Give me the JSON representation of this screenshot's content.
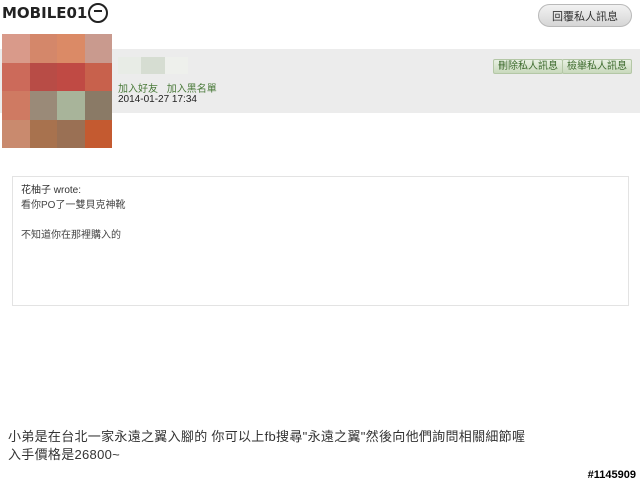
{
  "site": {
    "logo_text": "MOBILE01"
  },
  "header": {
    "reply_button": "回覆私人訊息"
  },
  "message": {
    "user_links": {
      "add_friend": "加入好友",
      "add_blacklist": "加入黑名單"
    },
    "date": "2014-01-27 17:34",
    "actions": {
      "delete": "刪除私人訊息",
      "report": "檢舉私人訊息"
    },
    "quote": {
      "author": "花柚子 wrote:",
      "line1": "看你PO了一雙貝克神靴",
      "line2": "不知道你在那裡購入的"
    },
    "body_line1": "小弟是在台北一家永遠之翼入腳的 你可以上fb搜尋\"永遠之翼\"然後向他們詢問相關細節喔",
    "body_line2": "入手價格是26800~"
  },
  "watermark": "#1145909",
  "colors": {
    "header_band": "#ececec",
    "link_green": "#4a7a3a",
    "action_button_bg": "#c9d9bd"
  },
  "avatar_colors": [
    "#d99a8a",
    "#d4876a",
    "#db8a66",
    "#c99a8e",
    "#cc6a5a",
    "#b84c46",
    "#c04a44",
    "#c8614c",
    "#cf7a62",
    "#9a8a78",
    "#a8b49a",
    "#8a7a66",
    "#c98a6e",
    "#a8724e",
    "#9a7054",
    "#c45a30"
  ],
  "name_blur_colors": [
    "#e8ece6",
    "#d6ddd2",
    "#eef0ec"
  ]
}
